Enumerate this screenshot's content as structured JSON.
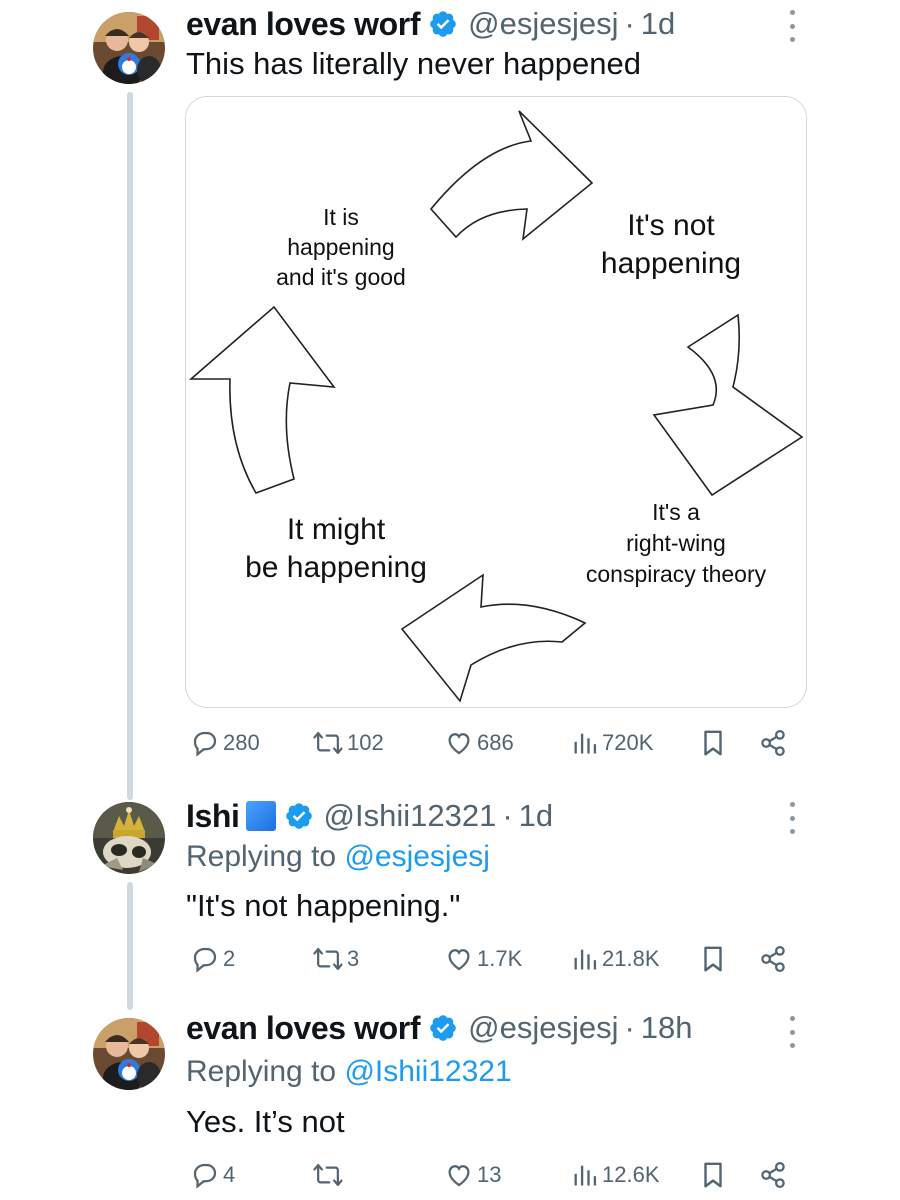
{
  "tweets": [
    {
      "name": "evan loves worf",
      "handle": "@esjesjesj",
      "separator": "·",
      "time": "1d",
      "text": "This has literally never happened",
      "media": {
        "labels": {
          "top_left": [
            "It is",
            "happening",
            "and it's good"
          ],
          "top_right": [
            "It's not",
            "happening"
          ],
          "bottom_right": [
            "It's a",
            "right-wing",
            "conspiracy theory"
          ],
          "bottom_left": [
            "It might",
            "be happening"
          ]
        }
      },
      "stats": {
        "replies": "280",
        "reposts": "102",
        "likes": "686",
        "views": "720K"
      }
    },
    {
      "name": "Ishi",
      "handle": "@Ishii12321",
      "separator": "·",
      "time": "1d",
      "replying_prefix": "Replying to ",
      "replying_to": "@esjesjesj",
      "text": "\"It's not happening.\"",
      "stats": {
        "replies": "2",
        "reposts": "3",
        "likes": "1.7K",
        "views": "21.8K"
      }
    },
    {
      "name": "evan loves worf",
      "handle": "@esjesjesj",
      "separator": "·",
      "time": "18h",
      "replying_prefix": "Replying to ",
      "replying_to": "@Ishii12321",
      "text": "Yes. It’s not",
      "stats": {
        "replies": "4",
        "reposts": "",
        "likes": "13",
        "views": "12.6K"
      }
    }
  ],
  "colors": {
    "accent": "#1d9bf0",
    "muted": "#536471",
    "verified": "#1d9bf0"
  },
  "icons": [
    "reply-icon",
    "repost-icon",
    "like-icon",
    "views-icon",
    "bookmark-icon",
    "share-icon",
    "more-icon",
    "verified-icon"
  ]
}
